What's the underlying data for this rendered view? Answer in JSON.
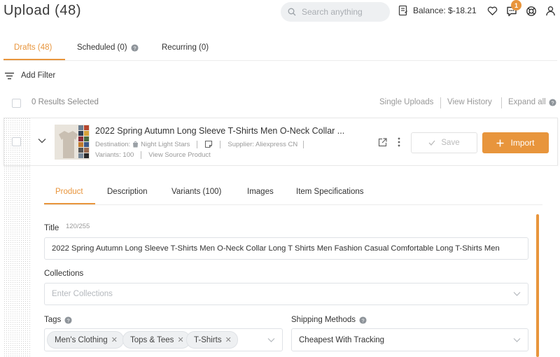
{
  "header": {
    "title": "Upload (48)",
    "search_placeholder": "Search anything",
    "balance": "Balance: $-18.21",
    "notification_count": "1"
  },
  "tabs": [
    {
      "label": "Drafts (48)",
      "active": true
    },
    {
      "label": "Scheduled (0)",
      "active": false
    },
    {
      "label": "Recurring (0)",
      "active": false
    }
  ],
  "filter_label": "Add Filter",
  "results": {
    "selected_text": "0 Results Selected",
    "links": [
      "Single Uploads",
      "View History",
      "Expand all"
    ]
  },
  "product": {
    "title": "2022 Spring Autumn Long Sleeve T-Shirts Men O-Neck Collar ...",
    "destination_label": "Destination:",
    "destination_value": "Night Light Stars",
    "supplier": "Supplier: Aliexpress CN",
    "variants": "Variants: 100",
    "view_source": "View Source Product",
    "save_label": "Save",
    "import_label": "Import"
  },
  "sub_tabs": [
    {
      "label": "Product",
      "active": true
    },
    {
      "label": "Description",
      "active": false
    },
    {
      "label": "Variants (100)",
      "active": false
    },
    {
      "label": "Images",
      "active": false
    },
    {
      "label": "Item Specifications",
      "active": false
    }
  ],
  "form": {
    "title_label": "Title",
    "title_count": "120/255",
    "title_value": "2022 Spring Autumn Long Sleeve T-Shirts Men O-Neck Collar Long T Shirts Men Fashion Casual Comfortable Long T-Shirts Men",
    "collections_label": "Collections",
    "collections_placeholder": "Enter Collections",
    "tags_label": "Tags",
    "tags": [
      "Men's Clothing",
      "Tops & Tees",
      "T-Shirts"
    ],
    "shipping_label": "Shipping Methods",
    "shipping_value": "Cheapest With Tracking"
  },
  "colors": {
    "accent": "#e8953c"
  }
}
